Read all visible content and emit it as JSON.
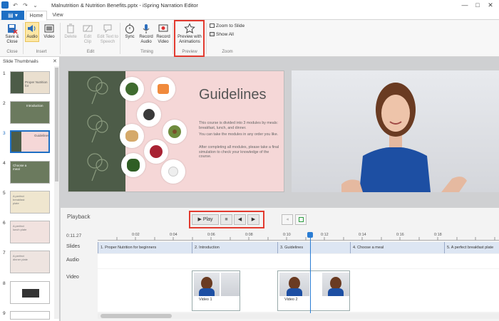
{
  "window": {
    "title": "Malnutrition & Nutrition Benefits.pptx - iSpring Narration Editor",
    "controls": {
      "minimize": "—",
      "maximize": "□",
      "close": "✕"
    }
  },
  "quick_access": {
    "undo": "↶",
    "redo": "↷",
    "more": "⌄"
  },
  "tabs": {
    "file": "▤ ▾",
    "home": "Home",
    "view": "View"
  },
  "ribbon": {
    "close_group": {
      "label": "Close",
      "save_close": "Save & Close"
    },
    "insert_group": {
      "label": "Insert",
      "audio": "Audio",
      "video": "Video"
    },
    "edit_group": {
      "label": "Edit",
      "delete": "Delete",
      "edit_clip": "Edit Clip",
      "edit_text": "Edit Text to Speech"
    },
    "timing_group": {
      "label": "Timing",
      "sync": "Sync",
      "record_audio": "Record Audio",
      "record_video": "Record Video"
    },
    "preview_group": {
      "label": "Preview",
      "preview_animations": "Preview with Animations"
    },
    "zoom_group": {
      "label": "Zoom",
      "zoom_to_slide": "Zoom to Slide",
      "show_all": "Show All"
    }
  },
  "thumbnails": {
    "header": "Slide Thumbnails",
    "items": [
      {
        "num": "1",
        "text": "Proper Nutrition for"
      },
      {
        "num": "2",
        "text": "Introduction"
      },
      {
        "num": "3",
        "text": "Guidelines"
      },
      {
        "num": "4",
        "text": "Choose a meal"
      },
      {
        "num": "5",
        "text": "A perfect breakfast plate"
      },
      {
        "num": "6",
        "text": "A perfect lunch plate"
      },
      {
        "num": "7",
        "text": "A perfect dinner plate"
      },
      {
        "num": "8",
        "text": ""
      },
      {
        "num": "9",
        "text": ""
      }
    ]
  },
  "slide": {
    "title": "Guidelines",
    "p1": "This course is divided into 3 modules by meals: breakfast, lunch, and dinner.",
    "p2": "You can take the modules in any order you like.",
    "p3": "After completing all modules, please take a final simulation to check your knowledge of the course."
  },
  "playback": {
    "label": "Playback",
    "play": "▶ Play",
    "stop": "■",
    "prev": "◀",
    "next": "▶",
    "current_time": "0:11.27"
  },
  "timeline": {
    "rows": {
      "slides": "Slides",
      "audio": "Audio",
      "video": "Video"
    },
    "ticks": [
      "0:02",
      "0:04",
      "0:06",
      "0:08",
      "0:10",
      "0:12",
      "0:14",
      "0:16",
      "0:18"
    ],
    "segments": [
      "1. Proper Nutrition for beginners",
      "2. Introduction",
      "3. Guidelines",
      "4. Choose a meal",
      "5. A perfect breakfast plate"
    ],
    "clips": [
      "Video 1",
      "Video 2"
    ]
  },
  "colors": {
    "accent": "#1e6fc4",
    "highlight": "#e23a2f",
    "slide_green": "#4d5c48",
    "slide_pink": "#f5d7d7"
  }
}
